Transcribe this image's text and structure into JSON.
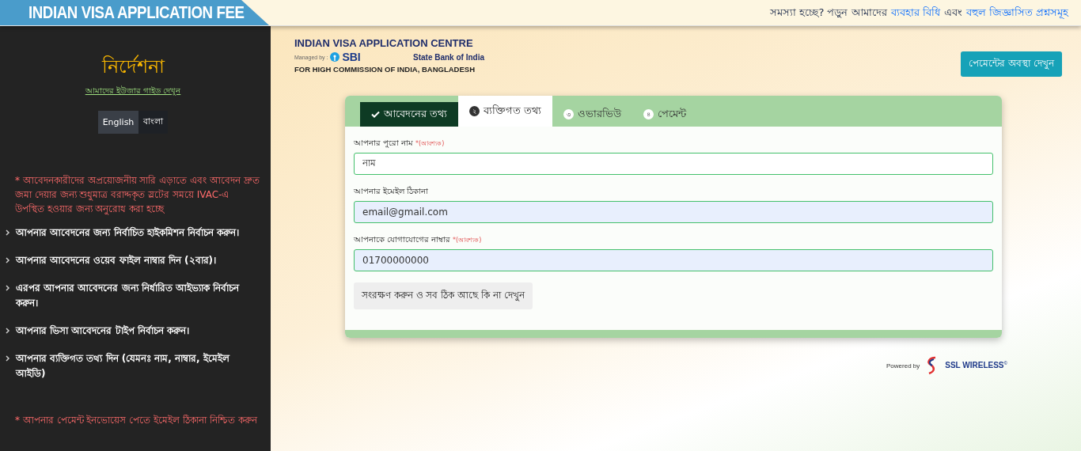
{
  "header": {
    "title": "INDIAN VISA APPLICATION FEE",
    "help": [
      {
        "kind": "text",
        "text": "সমস্যা হচ্ছে? পড়ুন আমাদের"
      },
      {
        "kind": "link",
        "text": "ব্যবহার বিধি"
      },
      {
        "kind": "text",
        "text": "এবং"
      },
      {
        "kind": "link",
        "text": "বহুল জিজ্ঞাসিত প্রশ্নসমূহ"
      }
    ]
  },
  "sidebar": {
    "title": "নির্দেশনা",
    "guide_link": "আমাদের ইউজার গাইড দেখুন",
    "languages": [
      {
        "label": "English",
        "selected": true
      },
      {
        "label": "বাংলা",
        "selected": false
      }
    ],
    "notice": "* আবেদনকারীদের অপ্রয়োজনীয় সারি এড়াতে এবং আবেদন দ্রুত জমা দেয়ার জন্য শুধুমাত্র বরাদ্দকৃত স্লটের সময়ে IVAC-এ উপস্থিত হওয়ার জন্য অনুরোধ করা হচ্ছে",
    "steps": [
      "আপনার আবেদনের জন্য নির্বাচিত হাইকমিশন নির্বাচন করুন।",
      "আপনার আবেদনের ওয়েব ফাইল নাম্বার দিন (২বার)।",
      "এরপর আপনার আবেদনের জন্য নির্ধারিত আইভ্যাক নির্বাচন করুন।",
      "আপনার ভিসা আবেদনের টাইপ নির্বাচন করুন।",
      "আপনার ব্যক্তিগত তথ্য দিন (যেমনঃ নাম, নাম্বার, ইমেইল আইডি)"
    ],
    "footer_notice": "* আপনার পেমেন্ট ইনভোয়েস পেতে ইমেইল ঠিকানা নিশ্চিত করুন"
  },
  "brand": {
    "title": "INDIAN VISA APPLICATION CENTRE",
    "managed_by": "Managed by :",
    "sbi": "SBI",
    "bank": "State Bank of India",
    "subtitle": "FOR HIGH COMMISSION OF INDIA, BANGLADESH"
  },
  "status_button": "পেমেন্টের অবস্থা দেখুন",
  "tabs": [
    {
      "label": "আবেদনের তথ্য",
      "done": true,
      "selected": false
    },
    {
      "number": "২",
      "label": "ব্যক্তিগত তথ্য",
      "done": false,
      "selected": true
    },
    {
      "number": "৩",
      "label": "ওভারভিউ",
      "done": false,
      "selected": false
    },
    {
      "number": "৪",
      "label": "পেমেন্ট",
      "done": false,
      "selected": false
    }
  ],
  "fields": [
    {
      "label": "আপনার পুরো নাম",
      "required": "*(আবশ্যক)",
      "value": "নাম",
      "autofilled": false
    },
    {
      "label": "আপনার ইমেইল ঠিকানা",
      "value": "email@gmail.com",
      "autofilled": true
    },
    {
      "label": "আপনাকে যোগাযোগের নাম্বার",
      "required": "*(আবশ্যক)",
      "value": "01700000000",
      "autofilled": true
    }
  ],
  "save_button": "সংরক্ষণ করুন ও সব ঠিক আছে কি না দেখুন",
  "powered": {
    "label": "Powered by",
    "brand": "SSL WIRELESS",
    "mark": "©"
  }
}
